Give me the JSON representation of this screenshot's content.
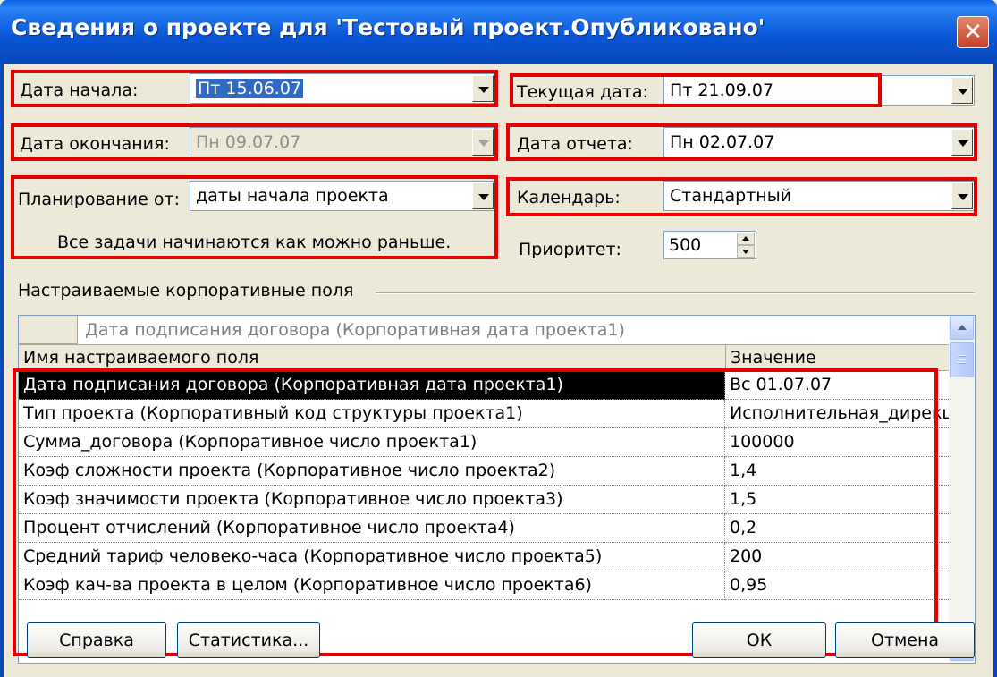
{
  "title": "Сведения о проекте для 'Тестовый проект.Опубликовано'",
  "close_symbol": "✕",
  "fields": {
    "start_date": {
      "label": "Дата начала:",
      "value": "Пт 15.06.07"
    },
    "finish_date": {
      "label": "Дата окончания:",
      "value": "Пн 09.07.07"
    },
    "schedule_from": {
      "label": "Планирование от:",
      "value": "даты начала проекта",
      "note": "Все задачи начинаются как можно раньше."
    },
    "current_date": {
      "label": "Текущая дата:",
      "value": "Пт 21.09.07"
    },
    "status_date": {
      "label": "Дата отчета:",
      "value": "Пн 02.07.07"
    },
    "calendar": {
      "label": "Календарь:",
      "value": "Стандартный"
    },
    "priority": {
      "label": "Приоритет:",
      "value": "500"
    }
  },
  "custom_fields": {
    "group_label": "Настраиваемые корпоративные поля",
    "edit_text": "Дата подписания договора (Корпоративная дата проекта1)",
    "columns": [
      "Имя настраиваемого поля",
      "Значение"
    ],
    "rows": [
      {
        "name": "Дата подписания договора (Корпоративная дата проекта1)",
        "value": "Вс 01.07.07"
      },
      {
        "name": "Тип проекта (Корпоративный код структуры проекта1)",
        "value": "Исполнительная_дирекция"
      },
      {
        "name": "Сумма_договора (Корпоративное число проекта1)",
        "value": "100000"
      },
      {
        "name": "Коэф сложности проекта (Корпоративное число проекта2)",
        "value": "1,4"
      },
      {
        "name": "Коэф значимости проекта (Корпоративное число проекта3)",
        "value": "1,5"
      },
      {
        "name": "Процент отчислений (Корпоративное число проекта4)",
        "value": "0,2"
      },
      {
        "name": "Средний тариф человеко-часа (Корпоративное число проекта5)",
        "value": "200"
      },
      {
        "name": "Коэф кач-ва проекта в целом (Корпоративное число проекта6)",
        "value": "0,95"
      }
    ]
  },
  "buttons": {
    "help": "Справка",
    "stats": "Статистика...",
    "ok": "ОК",
    "cancel": "Отмена"
  },
  "colors": {
    "titlebar": "#0A57D8",
    "highlight_box": "#E40000",
    "dialog_bg": "#ECE9D8"
  }
}
